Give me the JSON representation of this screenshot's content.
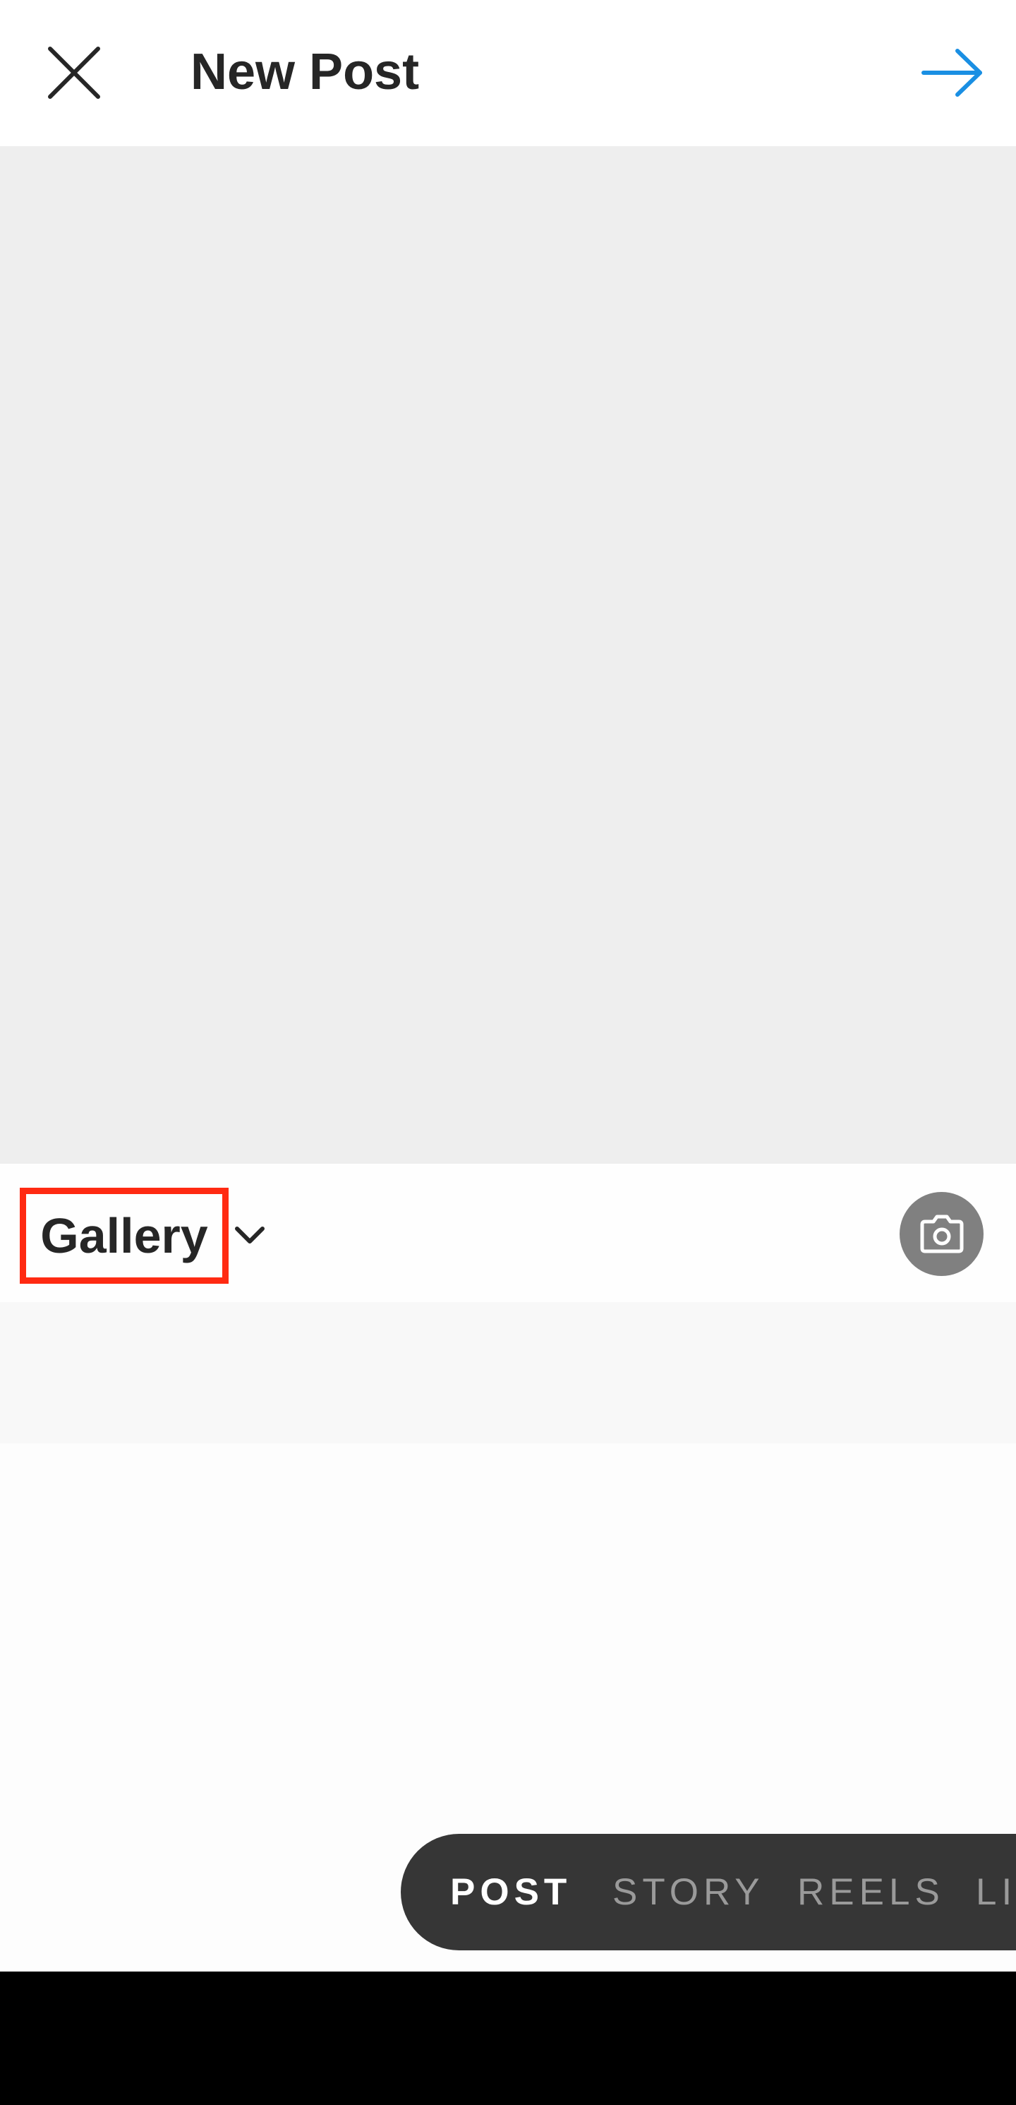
{
  "header": {
    "title": "New Post",
    "close_icon": "close-icon",
    "next_icon": "arrow-right-icon",
    "accent_color": "#1a8fe3"
  },
  "gallery": {
    "label": "Gallery",
    "chevron_icon": "chevron-down-icon",
    "camera_icon": "camera-icon",
    "highlight_color": "#ff2a12"
  },
  "modes": {
    "post": "POST",
    "story": "STORY",
    "reels": "REELS",
    "live": "LIVE"
  }
}
